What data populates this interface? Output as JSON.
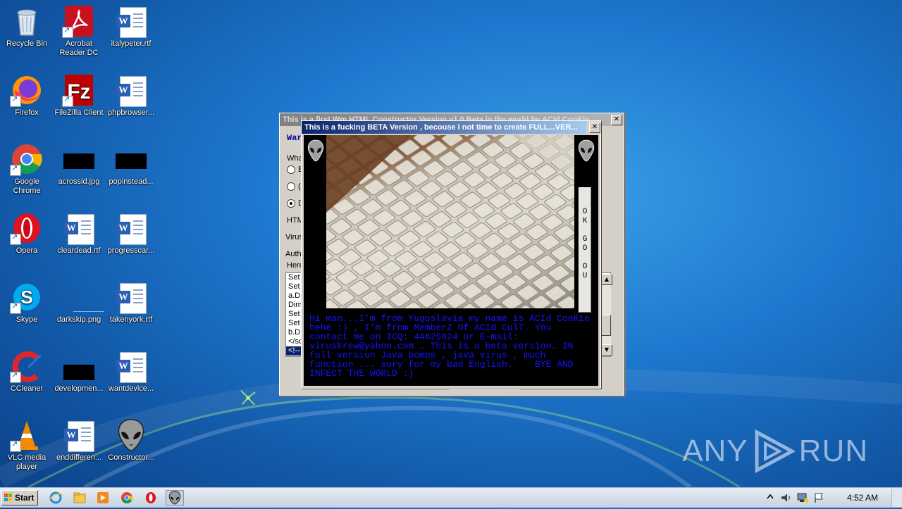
{
  "desktop": {
    "icons": [
      {
        "label": "Recycle Bin"
      },
      {
        "label": "Acrobat Reader DC"
      },
      {
        "label": "italypeter.rtf"
      },
      {
        "label": "Firefox"
      },
      {
        "label": "FileZilla Client"
      },
      {
        "label": "phpbrowser..."
      },
      {
        "label": "Google Chrome"
      },
      {
        "label": "acrossid.jpg"
      },
      {
        "label": "popinstead..."
      },
      {
        "label": "Opera"
      },
      {
        "label": "cleardead.rtf"
      },
      {
        "label": "progresscar..."
      },
      {
        "label": "Skype"
      },
      {
        "label": "darkskip.png"
      },
      {
        "label": "takenyork.rtf"
      },
      {
        "label": "CCleaner"
      },
      {
        "label": "developmen..."
      },
      {
        "label": "wantdevice..."
      },
      {
        "label": "VLC media player"
      },
      {
        "label": "enddifferen..."
      },
      {
        "label": "Constructor..."
      }
    ],
    "watermark": {
      "text_left": "ANY",
      "text_right": "RUN"
    }
  },
  "main_window": {
    "title": "This is a first Wm HTML Constructor Version v1.0 Beta in the world by ACId CooKie ...",
    "frag_war": "War",
    "frag_what": "What",
    "frag_radio1": "E",
    "frag_radio2": "(",
    "frag_radio3": "D",
    "frag_htm": "HTM",
    "frag_virus": "Virus",
    "frag_auth": "Auth",
    "frag_here": "Here",
    "code_lines": [
      "Set",
      "Set",
      "a.D",
      "Dim",
      "Set",
      "Set",
      "b.D",
      "</sc",
      "<!--"
    ],
    "close_glyph": "✕"
  },
  "popup": {
    "title": "This is a fucking BETA Version , becouse I not time to create FULL...VER...",
    "close_glyph": "✕",
    "ok_button_chars": [
      "O",
      "K",
      "",
      "G",
      "O",
      "",
      "O",
      "U"
    ],
    "message": "Hi man...I'm from Yugoslavia my name is ACId CooKie hehe :) , I'm from MemberZ Of ACId CulT. You contact me on ICQ: 44625824 or E-mail: viruskrew@yahoo.com . This is a beta version. IN full version Java bombs , java virus , much function ... sory for my bad English.    BYE AND INFECT THE WORLD :)",
    "colors": {
      "message": "#1414ff",
      "background": "#000000"
    }
  },
  "taskbar": {
    "start_label": "Start",
    "clock": "4:52 AM",
    "items": [
      {
        "icon": "internet-explorer-icon"
      },
      {
        "icon": "file-explorer-icon"
      },
      {
        "icon": "media-player-icon"
      },
      {
        "icon": "chrome-icon"
      },
      {
        "icon": "opera-icon"
      },
      {
        "icon": "constructor-alien-icon",
        "active": true
      }
    ],
    "tray": [
      "show-hidden-icons",
      "volume-icon",
      "network-icon",
      "action-center-flag-icon"
    ]
  }
}
